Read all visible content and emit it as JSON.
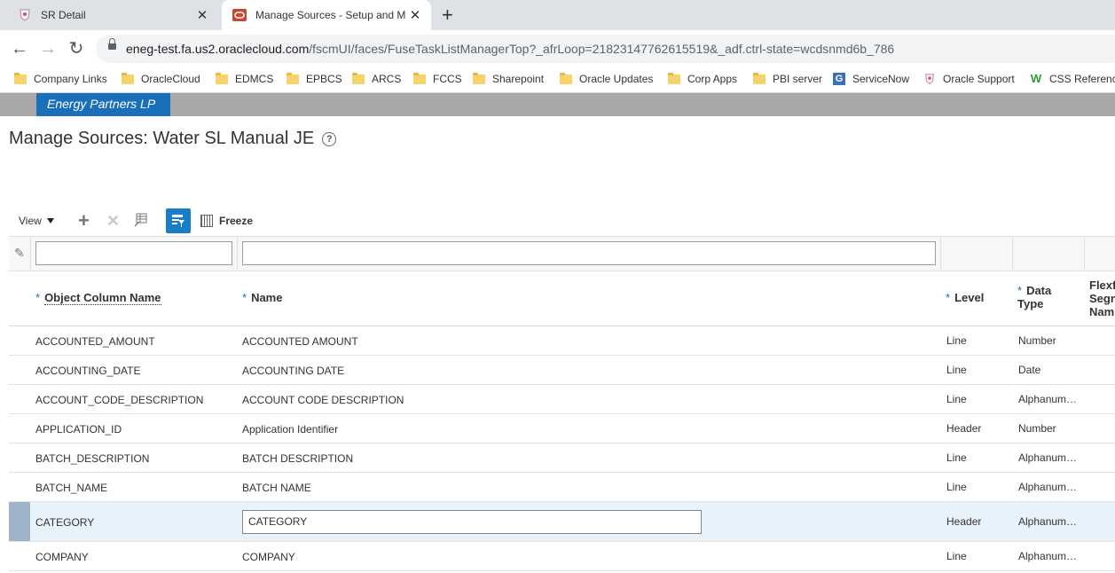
{
  "browser": {
    "tabs": [
      {
        "title": "SR Detail",
        "active": false,
        "favicon": "oracle-support-icon"
      },
      {
        "title": "Manage Sources - Setup and Ma",
        "active": true,
        "favicon": "oracle-icon"
      }
    ],
    "url_host": "eneg-test.fa.us2.oraclecloud.com",
    "url_path": "/fscmUI/faces/FuseTaskListManagerTop?_afrLoop=21823147762615519&_adf.ctrl-state=wcdsnmd6b_786",
    "bookmarks": [
      {
        "label": "Company Links",
        "icon": "folder-icon"
      },
      {
        "label": "OracleCloud",
        "icon": "folder-icon"
      },
      {
        "label": "EDMCS",
        "icon": "folder-icon"
      },
      {
        "label": "EPBCS",
        "icon": "folder-icon"
      },
      {
        "label": "ARCS",
        "icon": "folder-icon"
      },
      {
        "label": "FCCS",
        "icon": "folder-icon"
      },
      {
        "label": "Sharepoint",
        "icon": "folder-icon"
      },
      {
        "label": "Oracle Updates",
        "icon": "folder-icon"
      },
      {
        "label": "Corp Apps",
        "icon": "folder-icon"
      },
      {
        "label": "PBI server",
        "icon": "folder-icon"
      },
      {
        "label": "ServiceNow",
        "icon": "servicenow-icon"
      },
      {
        "label": "Oracle Support",
        "icon": "oracle-support-icon"
      },
      {
        "label": "CSS Reference",
        "icon": "w-icon"
      }
    ]
  },
  "app": {
    "brand": "Energy Partners LP",
    "page_title": "Manage Sources: Water SL Manual JE"
  },
  "toolbar": {
    "view_label": "View",
    "freeze_label": "Freeze"
  },
  "table": {
    "columns": [
      {
        "label": "Object Column Name",
        "required": true
      },
      {
        "label": "Name",
        "required": true
      },
      {
        "label": "Level",
        "required": true
      },
      {
        "label_line1": "Data",
        "label_line2": "Type",
        "required": true
      },
      {
        "label_line1": "Flexf",
        "label_line2": "Segn",
        "label_line3": "Nam"
      }
    ],
    "rows": [
      {
        "object_column_name": "ACCOUNTED_AMOUNT",
        "name": "ACCOUNTED AMOUNT",
        "level": "Line",
        "data_type": "Number"
      },
      {
        "object_column_name": "ACCOUNTING_DATE",
        "name": "ACCOUNTING DATE",
        "level": "Line",
        "data_type": "Date"
      },
      {
        "object_column_name": "ACCOUNT_CODE_DESCRIPTION",
        "name": "ACCOUNT CODE DESCRIPTION",
        "level": "Line",
        "data_type": "Alphanum…"
      },
      {
        "object_column_name": "APPLICATION_ID",
        "name": "Application Identifier",
        "level": "Header",
        "data_type": "Number"
      },
      {
        "object_column_name": "BATCH_DESCRIPTION",
        "name": "BATCH DESCRIPTION",
        "level": "Line",
        "data_type": "Alphanum…"
      },
      {
        "object_column_name": "BATCH_NAME",
        "name": "BATCH NAME",
        "level": "Line",
        "data_type": "Alphanum…"
      },
      {
        "object_column_name": "CATEGORY",
        "name": "CATEGORY",
        "level": "Header",
        "data_type": "Alphanum…",
        "selected": true
      },
      {
        "object_column_name": "COMPANY",
        "name": "COMPANY",
        "level": "Line",
        "data_type": "Alphanum…"
      }
    ]
  },
  "colors": {
    "brand_blue": "#1a6fba",
    "header_gray": "#a8a8a8",
    "selected_row": "#e8f2fb",
    "qbe_button": "#1a7dc8"
  }
}
